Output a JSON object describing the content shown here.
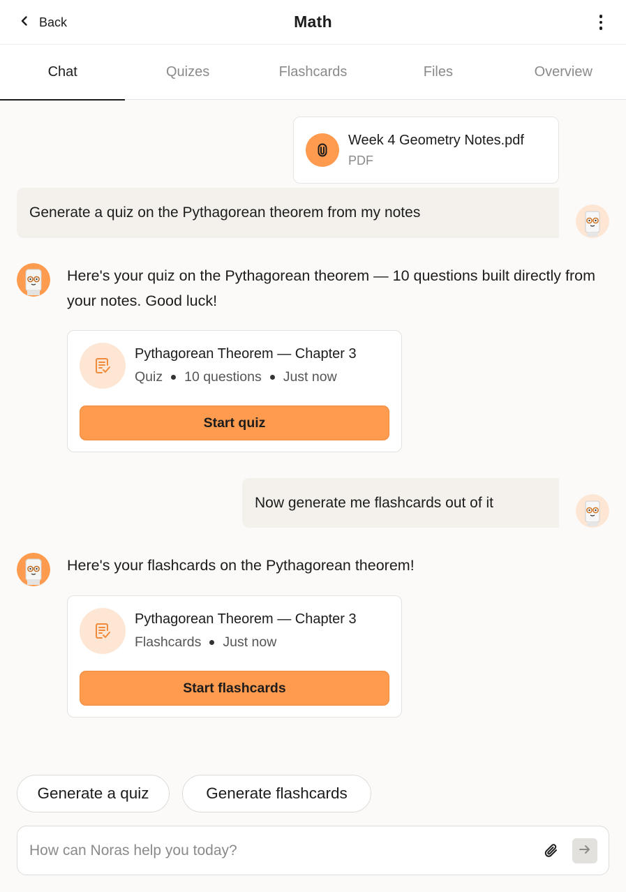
{
  "header": {
    "back_label": "Back",
    "title": "Math",
    "icons": {
      "back": "chevron-left-icon",
      "menu": "more-vertical-icon"
    }
  },
  "tabs": [
    {
      "label": "Chat",
      "active": true
    },
    {
      "label": "Quizes",
      "active": false
    },
    {
      "label": "Flashcards",
      "active": false
    },
    {
      "label": "Files",
      "active": false
    },
    {
      "label": "Overview",
      "active": false
    }
  ],
  "messages": {
    "attachment": {
      "name": "Week 4 Geometry Notes.pdf",
      "type": "PDF",
      "icon": "paperclip-icon"
    },
    "user_1": "Generate a quiz on the Pythagorean theorem from my notes",
    "bot_1": "Here's your quiz on the Pythagorean theorem — 10 questions built directly from your notes. Good luck!",
    "quiz_card": {
      "title": "Pythagorean Theorem — Chapter 3",
      "meta": [
        "Quiz",
        "10 questions",
        "Just now"
      ],
      "button": "Start quiz",
      "icon": "document-check-icon"
    },
    "user_2": "Now generate me flashcards out of it",
    "bot_2": "Here's your flashcards on the Pythagorean theorem!",
    "flash_card": {
      "title": "Pythagorean Theorem — Chapter 3",
      "meta": [
        "Flashcards",
        "Just now"
      ],
      "button": "Start flashcards",
      "icon": "document-check-icon"
    }
  },
  "suggestions": [
    "Generate a quiz",
    "Generate flashcards"
  ],
  "composer": {
    "placeholder": "How can Noras help you today?",
    "icons": {
      "attach": "paperclip-icon",
      "send": "arrow-right-icon"
    }
  },
  "colors": {
    "accent": "#ff9b4f",
    "accent_light": "#fde6d3",
    "background": "#fbfaf8",
    "user_bubble": "#f4f1ed"
  }
}
